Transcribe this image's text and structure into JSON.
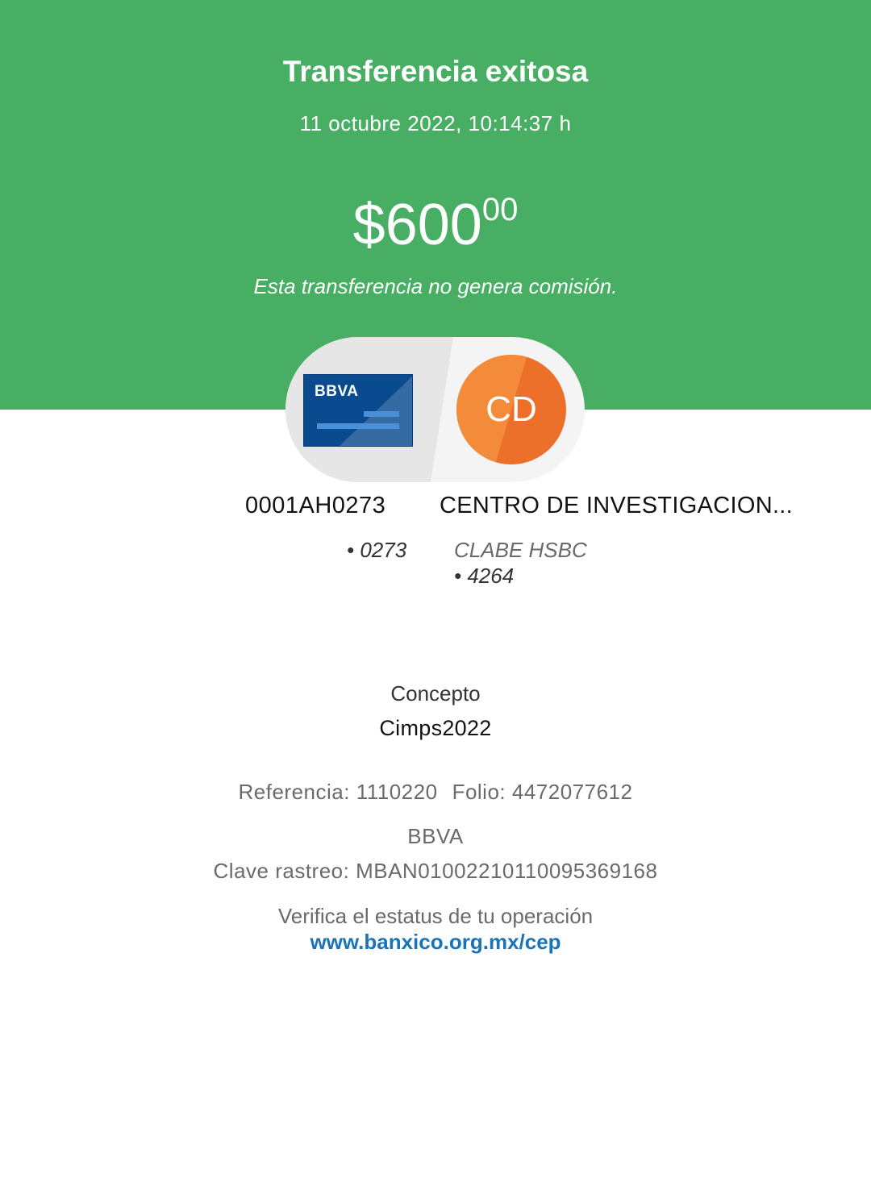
{
  "header": {
    "title": "Transferencia exitosa",
    "datetime": "11 octubre 2022, 10:14:37 h",
    "amount_main": "$600",
    "amount_cents": "00",
    "fee_note": "Esta transferencia no genera comisión.",
    "background_color": "#48ae64"
  },
  "origin": {
    "card_logo": "BBVA",
    "name": "0001AH0273",
    "account": "• 0273",
    "icon": "bank-card-icon"
  },
  "destination": {
    "initials": "CD",
    "name": "CENTRO DE INVESTIGACION...",
    "bank": "CLABE HSBC",
    "account": "• 4264",
    "avatar_color": "#ec6f2a"
  },
  "details": {
    "concept_label": "Concepto",
    "concept_value": "Cimps2022",
    "reference": "Referencia: 1110220",
    "folio": "Folio: 4472077612",
    "bank": "BBVA",
    "tracking_key": "Clave rastreo: MBAN01002210110095369168",
    "verify_text": "Verifica el estatus de tu operación",
    "verify_link": "www.banxico.org.mx/cep",
    "link_color": "#1973b8"
  }
}
